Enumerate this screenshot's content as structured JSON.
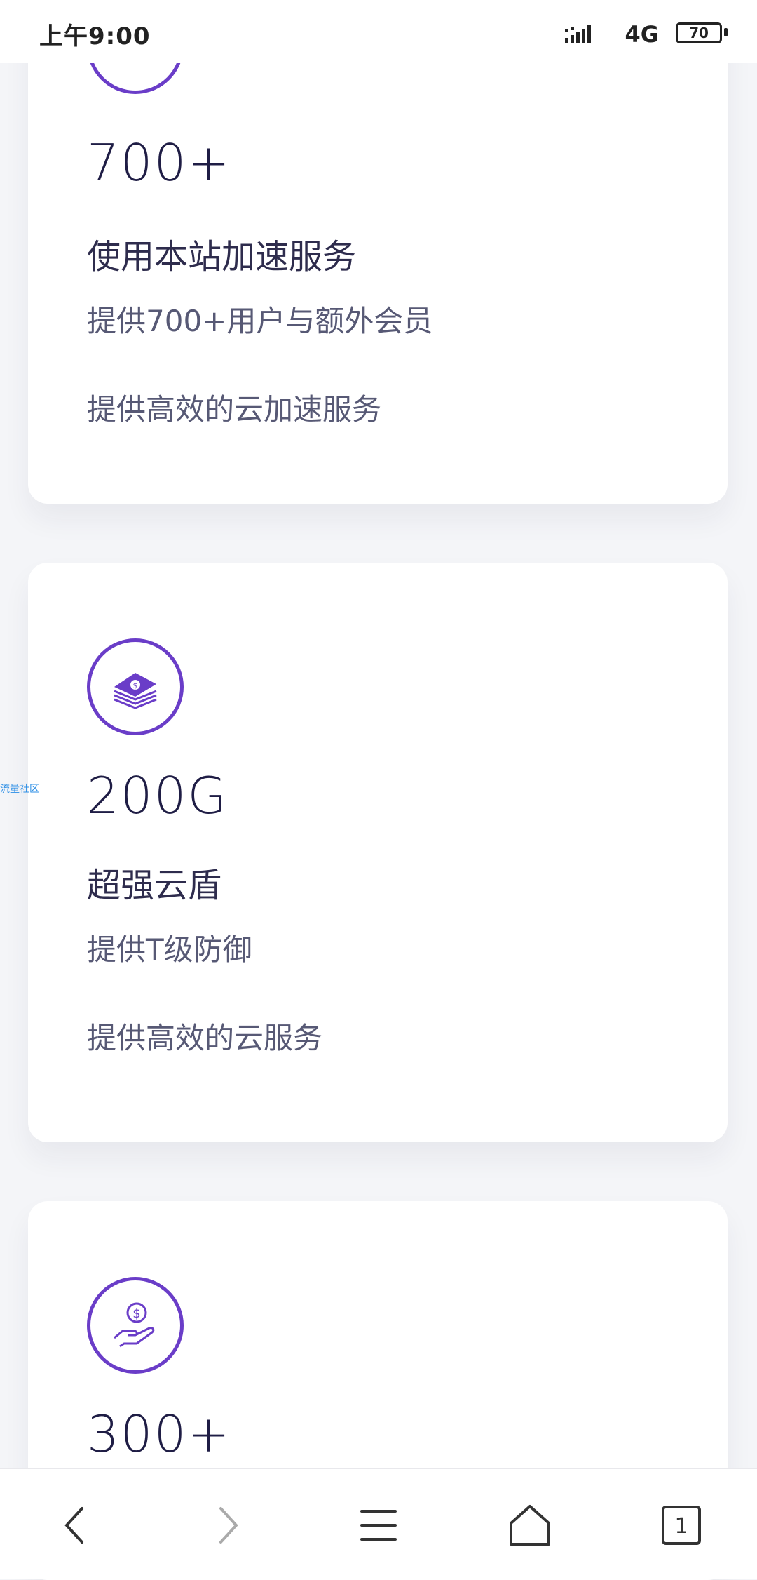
{
  "status": {
    "time": "上午9:00",
    "network": "4G",
    "battery": "70"
  },
  "cards": [
    {
      "value": "700+",
      "title": "使用本站加速服务",
      "line1": "提供700+用户与额外会员",
      "line2": "提供高效的云加速服务",
      "icon": "headset-icon"
    },
    {
      "value": "200G",
      "title": "超强云盾",
      "line1": "提供T级防御",
      "line2": "提供高效的云服务",
      "icon": "money-stack-icon"
    },
    {
      "value": "300+",
      "icon": "hand-coin-icon"
    }
  ],
  "side_label": "流量社区",
  "nav": {
    "tab_count": "1",
    "items": [
      "back-icon",
      "forward-icon",
      "menu-icon",
      "home-icon",
      "tabs-icon"
    ]
  },
  "colors": {
    "accent": "#6a3dc8",
    "background": "#f4f5f8",
    "value_text": "#1f1d45"
  }
}
